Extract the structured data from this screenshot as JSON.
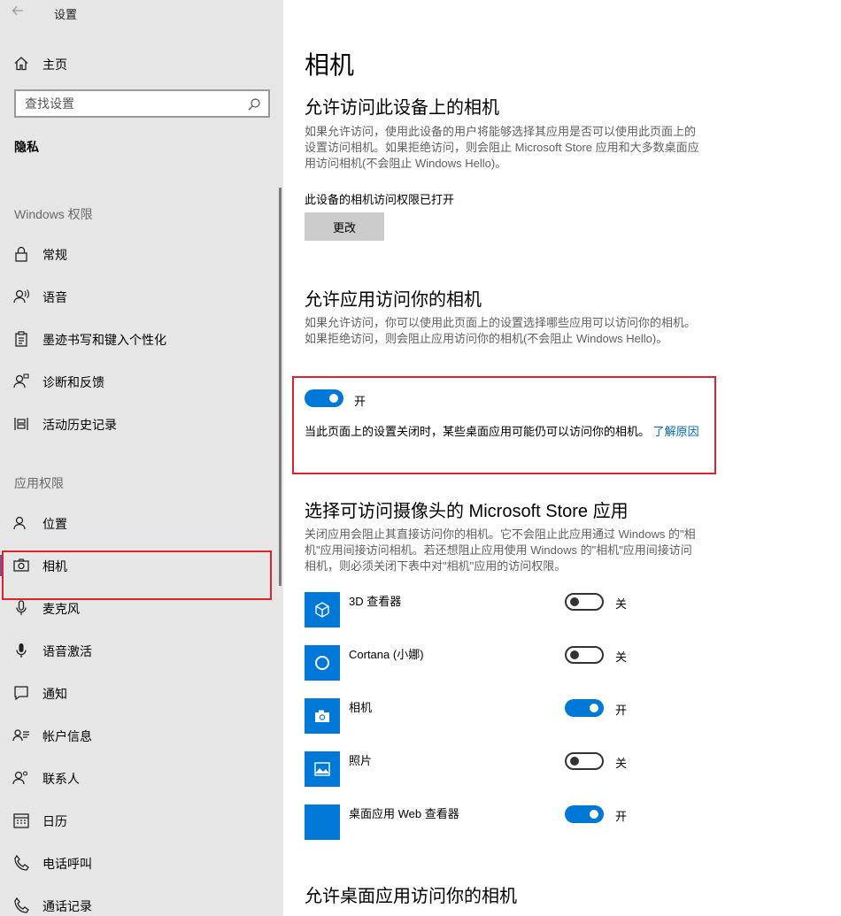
{
  "window": {
    "title": "设置"
  },
  "sidebar": {
    "home_label": "主页",
    "search_placeholder": "查找设置",
    "section_title": "隐私",
    "groups": [
      {
        "label": "Windows 权限"
      },
      {
        "label": "应用权限"
      }
    ],
    "windows_items": [
      {
        "label": "常规",
        "icon": "lock-icon"
      },
      {
        "label": "语音",
        "icon": "speech-icon"
      },
      {
        "label": "墨迹书写和键入个性化",
        "icon": "clipboard-icon"
      },
      {
        "label": "诊断和反馈",
        "icon": "person-feedback-icon"
      },
      {
        "label": "活动历史记录",
        "icon": "timeline-icon"
      }
    ],
    "app_items": [
      {
        "label": "位置",
        "icon": "person-location-icon"
      },
      {
        "label": "相机",
        "icon": "camera-icon",
        "active": true
      },
      {
        "label": "麦克风",
        "icon": "microphone-icon"
      },
      {
        "label": "语音激活",
        "icon": "voice-activation-icon"
      },
      {
        "label": "通知",
        "icon": "notification-icon"
      },
      {
        "label": "帐户信息",
        "icon": "account-info-icon"
      },
      {
        "label": "联系人",
        "icon": "contacts-icon"
      },
      {
        "label": "日历",
        "icon": "calendar-icon"
      },
      {
        "label": "电话呼叫",
        "icon": "phone-icon"
      },
      {
        "label": "通话记录",
        "icon": "call-history-icon"
      }
    ]
  },
  "main": {
    "page_title": "相机",
    "device_section": {
      "heading": "允许访问此设备上的相机",
      "description": "如果允许访问，使用此设备的用户将能够选择其应用是否可以使用此页面上的设置访问相机。如果拒绝访问，则会阻止 Microsoft Store 应用和大多数桌面应用访问相机(不会阻止 Windows Hello)。",
      "status": "此设备的相机访问权限已打开",
      "change_button": "更改"
    },
    "apps_access_section": {
      "heading": "允许应用访问你的相机",
      "description": "如果允许访问，你可以使用此页面上的设置选择哪些应用可以访问你的相机。如果拒绝访问，则会阻止应用访问你的相机(不会阻止 Windows Hello)。",
      "toggle_state": "开",
      "note": "当此页面上的设置关闭时，某些桌面应用可能仍可以访问你的相机。",
      "link": "了解原因"
    },
    "store_apps_section": {
      "heading": "选择可访问摄像头的 Microsoft Store 应用",
      "description": "关闭应用会阻止其直接访问你的相机。它不会阻止此应用通过 Windows 的\"相机\"应用间接访问相机。若还想阻止应用使用 Windows 的\"相机\"应用间接访问相机，则必须关闭下表中对\"相机\"应用的访问权限。",
      "apps": [
        {
          "name": "3D 查看器",
          "state": "关",
          "on": false,
          "icon": "cube-icon"
        },
        {
          "name": "Cortana (小娜)",
          "state": "关",
          "on": false,
          "icon": "cortana-ring-icon"
        },
        {
          "name": "相机",
          "state": "开",
          "on": true,
          "icon": "camera-app-icon"
        },
        {
          "name": "照片",
          "state": "关",
          "on": false,
          "icon": "photos-icon"
        },
        {
          "name": "桌面应用 Web 查看器",
          "state": "开",
          "on": true,
          "icon": "blank-tile-icon"
        }
      ]
    },
    "desktop_section": {
      "heading": "允许桌面应用访问你的相机"
    }
  },
  "colors": {
    "accent": "#0078d7",
    "highlight_box": "#e0222e",
    "active_indicator": "#7a4d96",
    "sidebar_bg": "#e6e6e6"
  }
}
